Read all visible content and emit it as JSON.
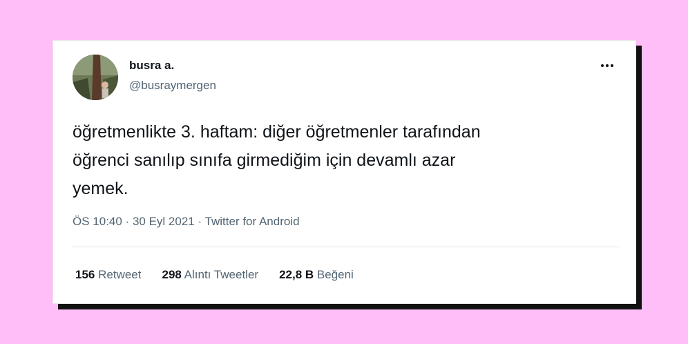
{
  "background_color": "#ffbef7",
  "tweet": {
    "author_name": "busra a.",
    "author_handle": "@busraymergen",
    "more_icon": "more-horizontal-icon",
    "text": "öğretmenlikte 3. haftam: diğer öğretmenler tarafından\nöğrenci sanılıp sınıfa girmediğim için devamlı azar\nyemek.",
    "time": "ÖS 10:40",
    "separator1": " · ",
    "date": "30 Eyl 2021",
    "separator2": " · ",
    "source": "Twitter for Android",
    "stats": [
      {
        "value": "156",
        "label": "Retweet"
      },
      {
        "value": "298",
        "label": "Alıntı Tweetler"
      },
      {
        "value": "22,8 B",
        "label": "Beğeni"
      }
    ]
  },
  "colors": {
    "text_primary": "#0f1419",
    "text_secondary": "#536471",
    "shadow": "#111111"
  }
}
